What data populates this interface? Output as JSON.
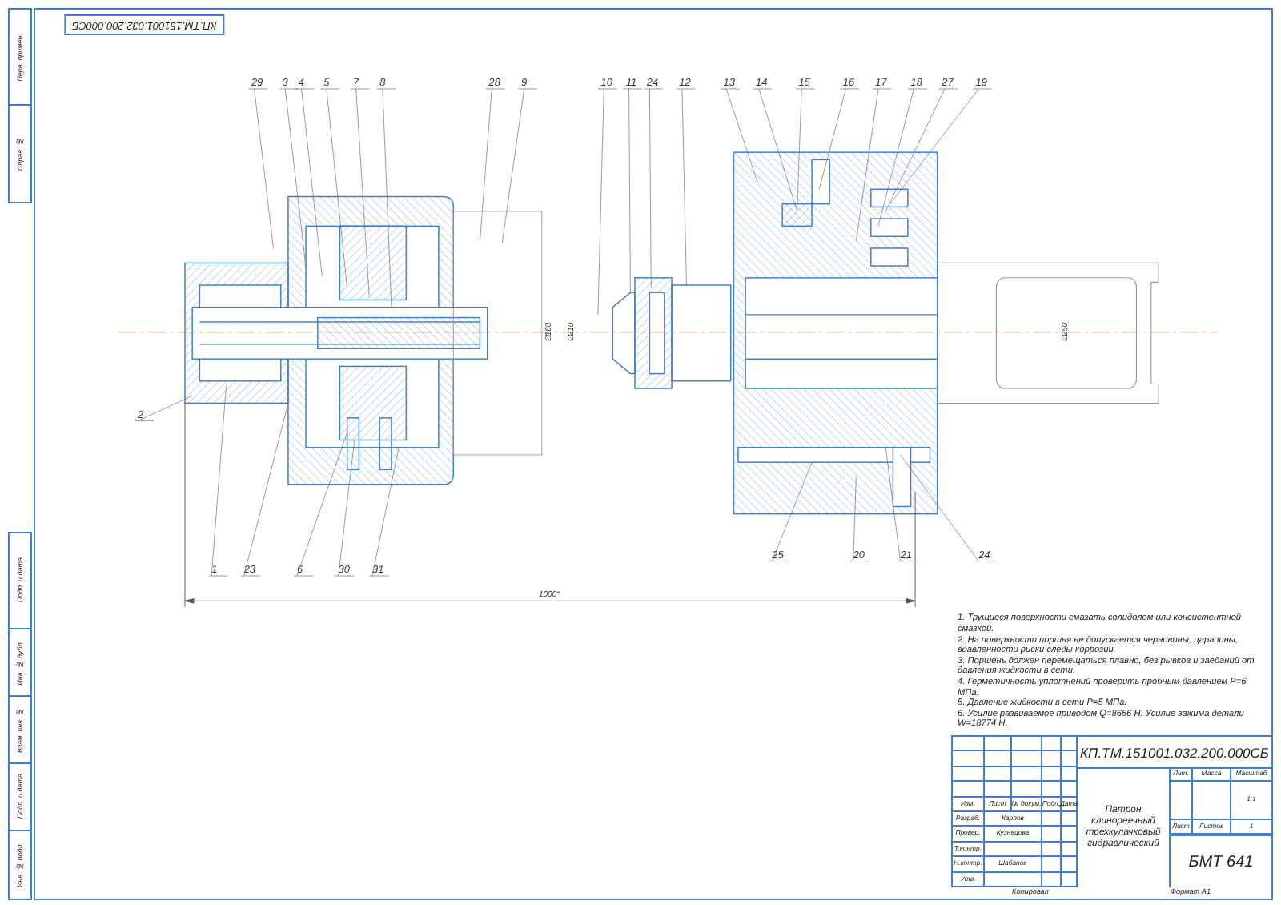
{
  "sheet": {
    "stamp_code": "КП.ТМ.151001.032.200.000СБ",
    "margin_stamp": {
      "top": [
        "Перв. примен.",
        "Справ. №"
      ],
      "bottom": [
        "Подп. и дата",
        "Инв. № дубл.",
        "Взам. инв. №",
        "Подп. и дата",
        "Инв. № подл."
      ]
    },
    "callouts": [
      {
        "number": "29"
      },
      {
        "number": "3"
      },
      {
        "number": "4"
      },
      {
        "number": "5"
      },
      {
        "number": "7"
      },
      {
        "number": "8"
      },
      {
        "number": "28"
      },
      {
        "number": "9"
      },
      {
        "number": "10"
      },
      {
        "number": "11"
      },
      {
        "number": "24"
      },
      {
        "number": "12"
      },
      {
        "number": "13"
      },
      {
        "number": "14"
      },
      {
        "number": "15"
      },
      {
        "number": "16"
      },
      {
        "number": "17"
      },
      {
        "number": "18"
      },
      {
        "number": "27"
      },
      {
        "number": "19"
      },
      {
        "number": "2"
      },
      {
        "number": "1"
      },
      {
        "number": "23"
      },
      {
        "number": "6"
      },
      {
        "number": "30"
      },
      {
        "number": "31"
      },
      {
        "number": "25"
      },
      {
        "number": "20"
      },
      {
        "number": "21"
      },
      {
        "number": "24"
      }
    ],
    "dimensions": {
      "overall_length": "1000*",
      "diameters": [
        "∅160",
        "∅210",
        "∅250"
      ]
    },
    "notes": [
      "1. Трущиеся поверхности смазать солидолом или консистентной смазкой.",
      "2. На поверхности поршня не допускается черновины, царапины, вдавленности риски следы коррозии.",
      "3. Поршень должен перемещаться плавно, без рывков и заеданий от давления жидкости в сети.",
      "4. Герметичность уплотнений проверить пробным давлением P=6 МПа.",
      "5. Давление жидкости в сети P=5 МПа.",
      "6. Усилие развиваемое приводом Q=8656 Н. Усилие зажима детали W=18774 Н."
    ],
    "title_block": {
      "code": "КП.ТМ.151001.032.200.000СБ",
      "name": "Патрон клинореечный трехкулачковый гидравлический",
      "header": [
        "Изм.",
        "Лист",
        "№ докум.",
        "Подп.",
        "Дата"
      ],
      "roles": [
        {
          "role": "Разраб.",
          "person": "Карпов"
        },
        {
          "role": "Провер.",
          "person": "Кузнецова"
        },
        {
          "role": "Т.контр."
        },
        {
          "role": "Н.контр.",
          "person": "Шабанов"
        },
        {
          "role": "Утв."
        }
      ],
      "lit_headers": [
        "Лит.",
        "Масса",
        "Масштаб"
      ],
      "scale": "1:1",
      "sheet_label": "Лист",
      "sheets_label": "Листов",
      "sheets_count": "1",
      "organization": "БМТ 641",
      "copied": "Копировал",
      "format": "Формат A1"
    }
  }
}
